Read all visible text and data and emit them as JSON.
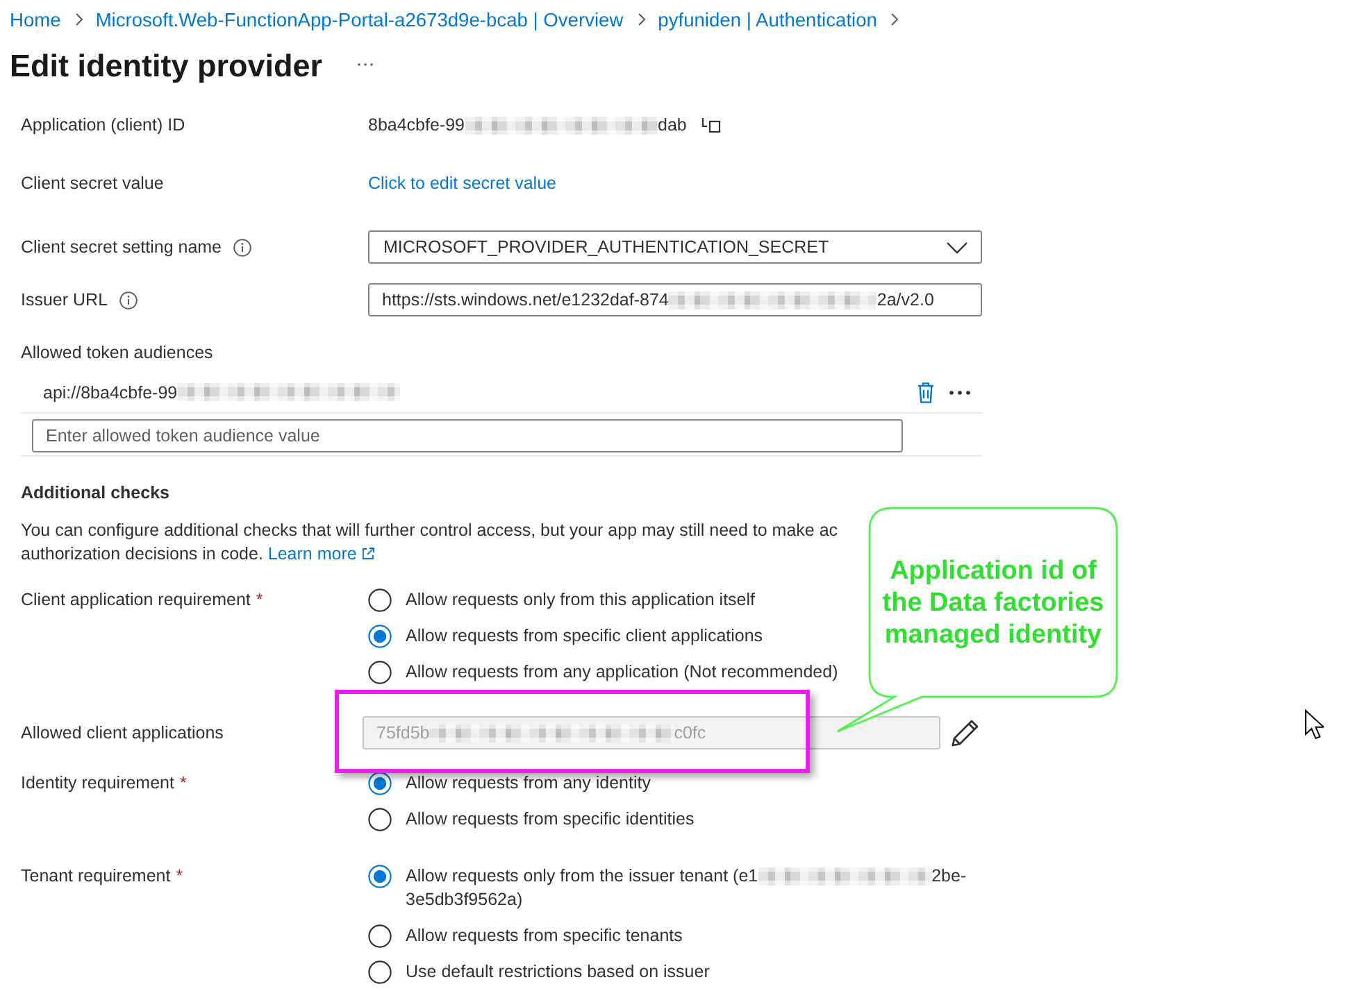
{
  "breadcrumb": [
    {
      "label": "Home"
    },
    {
      "label": "Microsoft.Web-FunctionApp-Portal-a2673d9e-bcab | Overview"
    },
    {
      "label": "pyfuniden | Authentication"
    }
  ],
  "title": "Edit identity provider",
  "application_id": {
    "label": "Application (client) ID",
    "value_start": "8ba4cbfe-99",
    "redacted": true,
    "value_end": "dab"
  },
  "client_secret": {
    "label": "Client secret value",
    "link": "Click to edit secret value"
  },
  "secret_setting_name": {
    "label": "Client secret setting name",
    "value": "MICROSOFT_PROVIDER_AUTHENTICATION_SECRET"
  },
  "issuer_url": {
    "label": "Issuer URL",
    "value_start": "https://sts.windows.net/e1232daf-874",
    "redacted": true,
    "value_end": "2a/v2.0"
  },
  "token_audiences": {
    "label": "Allowed token audiences",
    "items": [
      {
        "value_start": "api://8ba4cbfe-99",
        "redacted": true
      }
    ],
    "placeholder": "Enter allowed token audience value"
  },
  "additional_checks": {
    "heading": "Additional checks",
    "description_lines": [
      "You can configure additional checks that will further control access, but your app may still need to make ac",
      "authorization decisions in code."
    ],
    "link": "Learn more"
  },
  "client_application_requirement": {
    "label": "Client application requirement",
    "required_mark": "*",
    "options": [
      {
        "label": "Allow requests only from this application itself",
        "selected": false
      },
      {
        "label": "Allow requests from specific client applications",
        "selected": true
      },
      {
        "label": "Allow requests from any application (Not recommended)",
        "selected": false
      }
    ]
  },
  "allowed_client_applications": {
    "label": "Allowed client applications",
    "value_start": "75fd5b",
    "redacted": true,
    "value_end": "c0fc",
    "disabled": true
  },
  "identity_requirement": {
    "label": "Identity requirement",
    "required_mark": "*",
    "options": [
      {
        "label": "Allow requests from any identity",
        "selected": true
      },
      {
        "label": "Allow requests from specific identities",
        "selected": false
      }
    ]
  },
  "tenant_requirement": {
    "label": "Tenant requirement",
    "required_mark": "*",
    "options": [
      {
        "label": "Allow requests only from the issuer tenant (e1",
        "redacted": true,
        "label_end": "2be-3e5db3f9562a)",
        "selected": true
      },
      {
        "label": "Allow requests from specific tenants",
        "redacted": false,
        "selected": false
      },
      {
        "label": "Use default restrictions based on issuer",
        "redacted": false,
        "selected": false
      }
    ]
  },
  "callout": {
    "text": "Application id of the Data factories managed identity"
  }
}
